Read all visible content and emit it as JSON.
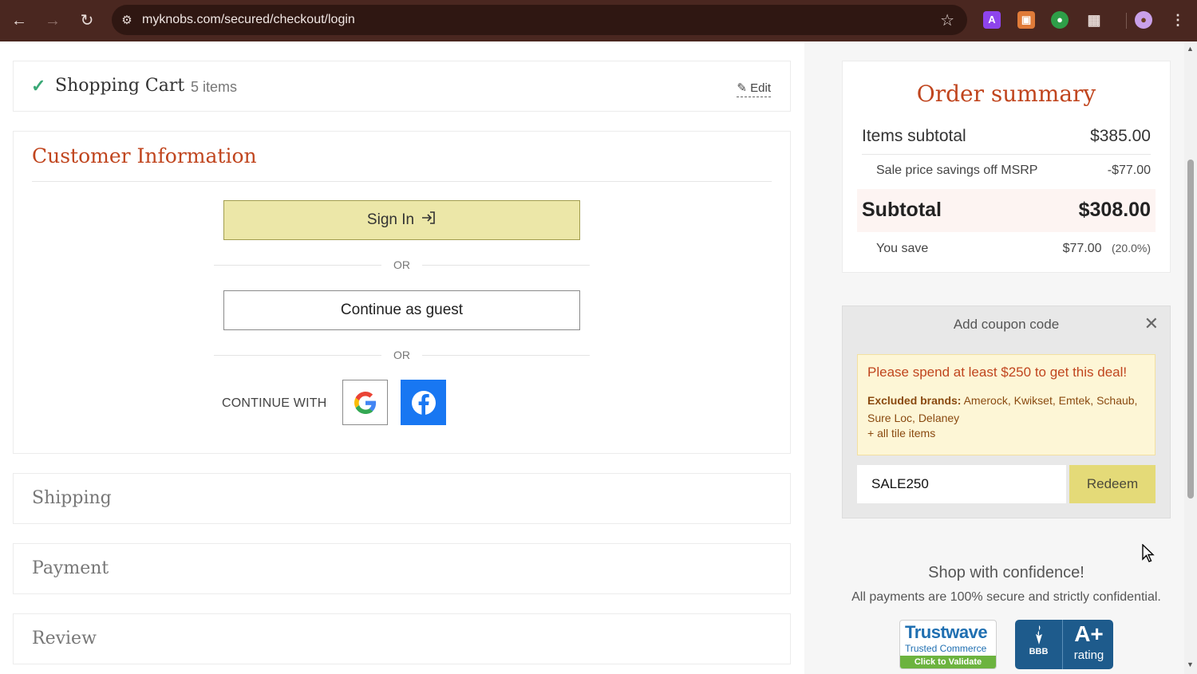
{
  "browser": {
    "url": "myknobs.com/secured/checkout/login"
  },
  "cart": {
    "title": "Shopping Cart",
    "count": "5 items",
    "edit_label": "Edit"
  },
  "customer": {
    "title": "Customer Information",
    "sign_in_label": "Sign In",
    "or_label": "OR",
    "guest_label": "Continue as guest",
    "continue_with_label": "CONTINUE WITH"
  },
  "sections": {
    "shipping": "Shipping",
    "payment": "Payment",
    "review": "Review"
  },
  "summary": {
    "title": "Order summary",
    "items_subtotal_label": "Items subtotal",
    "items_subtotal_value": "$385.00",
    "savings_label": "Sale price savings off MSRP",
    "savings_value": "-$77.00",
    "subtotal_label": "Subtotal",
    "subtotal_value": "$308.00",
    "you_save_label": "You save",
    "you_save_value": "$77.00",
    "you_save_pct": "(20.0%)"
  },
  "coupon": {
    "header": "Add coupon code",
    "deal_message": "Please spend at least $250 to get this deal!",
    "excluded_label": "Excluded brands:",
    "excluded_brands": "Amerock, Kwikset, Emtek, Schaub, Sure Loc, Delaney",
    "tile_note": "+ all tile items",
    "code_value": "SALE250",
    "redeem_label": "Redeem"
  },
  "trust": {
    "headline": "Shop with confidence!",
    "subline": "All payments are 100% secure and strictly confidential.",
    "trustwave_name": "Trustwave",
    "trustwave_sub": "Trusted Commerce",
    "trustwave_cta": "Click to Validate",
    "bbb_label": "BBB",
    "bbb_grade": "A+",
    "bbb_rating": "rating"
  },
  "colors": {
    "accent": "#c0451e",
    "signin_bg": "#ece7a8",
    "redeem_bg": "#e4da78",
    "facebook": "#1877f2",
    "chrome_bg": "#4a2720"
  }
}
